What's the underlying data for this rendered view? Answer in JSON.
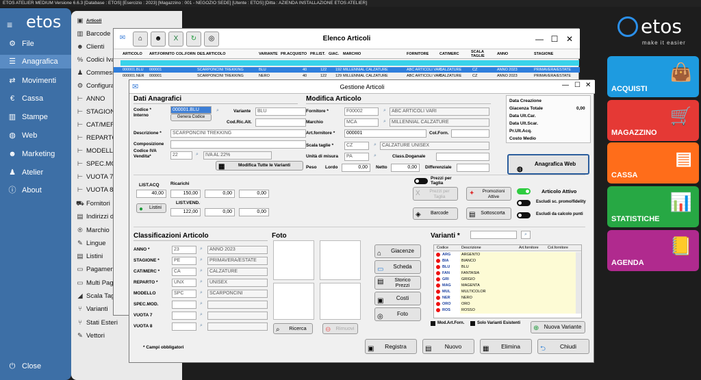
{
  "titlebar": "ETOS ATELIER MEDIUM     Versione 6.6.3   [Database : ETOS]    [Esercizio : 2023]    [Magazzino : 001 - NEGOZIO SEDE]    [Utente : ETOS]    [Ditta : AZIENDA INSTALLAZIONE ETOS ATELIER]",
  "sidebar": {
    "logo": "etos",
    "items": [
      {
        "label": "File",
        "icon": "gear-icon"
      },
      {
        "label": "Anagrafica",
        "icon": "database-icon"
      },
      {
        "label": "Movimenti",
        "icon": "exchange-icon"
      },
      {
        "label": "Cassa",
        "icon": "euro-icon"
      },
      {
        "label": "Stampe",
        "icon": "chart-icon"
      },
      {
        "label": "Web",
        "icon": "globe-icon"
      },
      {
        "label": "Marketing",
        "icon": "users-icon"
      },
      {
        "label": "Atelier",
        "icon": "person-icon"
      },
      {
        "label": "About",
        "icon": "info-icon"
      }
    ],
    "close": "Close"
  },
  "submenu": [
    "Articoli",
    "Barcode",
    "Clienti",
    "Codici Iva",
    "Commessi",
    "Configura",
    "ANNO",
    "STAGIONI",
    "CAT/MERC",
    "REPARTO",
    "MODELLO",
    "SPEC.MOD",
    "VUOTA 7",
    "VUOTA 8",
    "Fornitori",
    "Indirizzi di",
    "Marchio",
    "Lingue",
    "Listini",
    "Pagamenti",
    "Multi Paga",
    "Scala Tagli",
    "Varianti",
    "Stati Esteri",
    "Vettori"
  ],
  "elenco": {
    "title": "Elenco Articoli",
    "columns": [
      "ARTICOLO",
      "ART.FORNITO",
      "COL.FORN",
      "DES.ARTICOLO",
      "VARIANTE",
      "PR.ACQUISTO",
      "PR.LIST.",
      "GIAC.",
      "MARCHIO",
      "FORNITORE",
      "CAT/MERC",
      "SCALA TAGLIE",
      "ANNO",
      "STAGIONE"
    ],
    "rows": [
      [
        "000001.BLU",
        "000001",
        "",
        "SCARPONCINI TREKKING",
        "BLU",
        "40",
        "122",
        "192",
        "MILLENNIAL CALZATURE",
        "ABC ARTICOLI VARI",
        "CALZATURE",
        "CZ",
        "ANNO 2023",
        "PRIMAVERA/ESTATE"
      ],
      [
        "000001.NER",
        "000001",
        "",
        "SCARPONCINI TREKKING",
        "NERO",
        "40",
        "122",
        "129",
        "MILLENNIAL CALZATURE",
        "ABC ARTICOLI VARI",
        "CALZATURE",
        "CZ",
        "ANNO 2023",
        "PRIMAVERA/ESTATE"
      ]
    ]
  },
  "gestione": {
    "title": "Gestione Articoli",
    "dati_title": "Dati Anagrafici",
    "codice_label": "Codice *\nInterno",
    "codice": "000001.BLU",
    "genera_codice": "Genera Codice",
    "variante_label": "Variante",
    "variante": "BLU",
    "codricalt_label": "Cod.Ric.Alt.",
    "descrizione_label": "Descrizione *",
    "descrizione": "SCARPONCINI TREKKING",
    "composizione_label": "Composizione",
    "codiva_label": "Codice IVA\nVendita*",
    "codiva": "22",
    "codiva_desc": "IVA AL 22%",
    "modifica_varianti": "Modifica Tutte le Varianti",
    "mod_title": "Modifica Articolo",
    "fornitore_label": "Fornitore *",
    "fornitore_code": "F00002",
    "fornitore_desc": "ABC ARTICOLI VARI",
    "marchio_label": "Marchio",
    "marchio_code": "MCA",
    "marchio_desc": "MILLENNIAL CALZATURE",
    "artforn_label": "Art.fornitore *",
    "artforn": "000001",
    "colforn_label": "Col.Forn.",
    "scala_label": "Scala taglie *",
    "scala_code": "CZ",
    "scala_desc": "CALZATURE UNISEX",
    "um_label": "Unità di misura",
    "um": "PA",
    "classdog_label": "Class.Doganale",
    "peso_label": "Peso",
    "lordo_label": "Lordo",
    "lordo": "0,00",
    "netto_label": "Netto",
    "netto": "0,00",
    "diff_label": "Differenziale",
    "info": [
      {
        "label": "Data Creazione",
        "value": ""
      },
      {
        "label": "Giacenza Totale",
        "value": "0,00"
      },
      {
        "label": "Data Ult.Car.",
        "value": ""
      },
      {
        "label": "Data Ult.Scar.",
        "value": ""
      },
      {
        "label": "Pr.Ult.Acq.",
        "value": ""
      },
      {
        "label": "Costo Medio",
        "value": ""
      }
    ],
    "anagrafica_web": "Anagrafica Web",
    "listacq_label": "LIST.ACQ",
    "ricarichi_label": "Ricarichi",
    "listvend_label": "LIST.VEND.",
    "acq": [
      "40,00",
      "150,00",
      "0,00",
      "0,00"
    ],
    "vend": [
      "122,00",
      "0,00",
      "0,00"
    ],
    "listini": "Listini",
    "prezzi_taglia": "Prezzi per\nTaglia",
    "prezzi_taglia_btn": "Prezzi per\nTaglia",
    "promozioni": "Promozioni\nAttive",
    "barcode": "Barcode",
    "sottoscorta": "Sottoscorta",
    "articolo_attivo": "Articolo Attivo",
    "escludi_promo": "Escludi sc. promo/fidelity",
    "escludi_punti": "Escludi da calcolo punti",
    "class_title": "Classificazioni Articolo",
    "class": [
      {
        "label": "ANNO *",
        "code": "23",
        "desc": "ANNO 2023"
      },
      {
        "label": "STAGIONE *",
        "code": "PE",
        "desc": "PRIMAVERA/ESTATE"
      },
      {
        "label": "CAT/MERC *",
        "code": "CA",
        "desc": "CALZATURE"
      },
      {
        "label": "REPARTO *",
        "code": "UNX",
        "desc": "UNISEX"
      },
      {
        "label": "MODELLO",
        "code": "SPC",
        "desc": "SCARPONCINI"
      },
      {
        "label": "SPEC.MOD.",
        "code": "",
        "desc": ""
      },
      {
        "label": "VUOTA 7",
        "code": "",
        "desc": ""
      },
      {
        "label": "VUOTA 8",
        "code": "",
        "desc": ""
      }
    ],
    "foto_title": "Foto",
    "ricerca": "Ricerca",
    "rimuovi": "Rimuovi",
    "side_btns": [
      "Giacenze",
      "Scheda",
      "Storico\nPrezzi",
      "Costi",
      "Foto"
    ],
    "varianti_title": "Varianti *",
    "var_cols": [
      "Codice",
      "Descrizione",
      "Art.fornitore",
      "Col.fornitore"
    ],
    "var_rows": [
      [
        "ARG",
        "ARGENTO"
      ],
      [
        "BIA",
        "BIANCO"
      ],
      [
        "BLU",
        "BLU"
      ],
      [
        "FAN",
        "FANTASIA"
      ],
      [
        "GRI",
        "GRIGIO"
      ],
      [
        "MAG",
        "MAGENTA"
      ],
      [
        "MUL",
        "MULTICOLOR"
      ],
      [
        "NER",
        "NERO"
      ],
      [
        "ORO",
        "ORO"
      ],
      [
        "ROS",
        "ROSSO"
      ]
    ],
    "mod_art_forn": "Mod.Art.Forn.",
    "solo_varianti": "Solo Varianti Esistenti",
    "nuova_variante": "Nuova Variante",
    "campi_obbl": "* Campi obbligatori",
    "footer": [
      "Registra",
      "Nuovo",
      "Elimina",
      "Chiudi"
    ]
  },
  "brand": {
    "logo": "etos",
    "tagline": "make it easier"
  },
  "tiles": [
    {
      "label": "ACQUISTI",
      "color": "#1e9be0",
      "icon": "bag-icon"
    },
    {
      "label": "MAGAZZINO",
      "color": "#e53935",
      "icon": "cart-icon"
    },
    {
      "label": "CASSA",
      "color": "#ff6d1a",
      "icon": "pos-icon"
    },
    {
      "label": "STATISTICHE",
      "color": "#27a844",
      "icon": "stats-icon"
    },
    {
      "label": "AGENDA",
      "color": "#b02a8e",
      "icon": "agenda-icon"
    }
  ]
}
